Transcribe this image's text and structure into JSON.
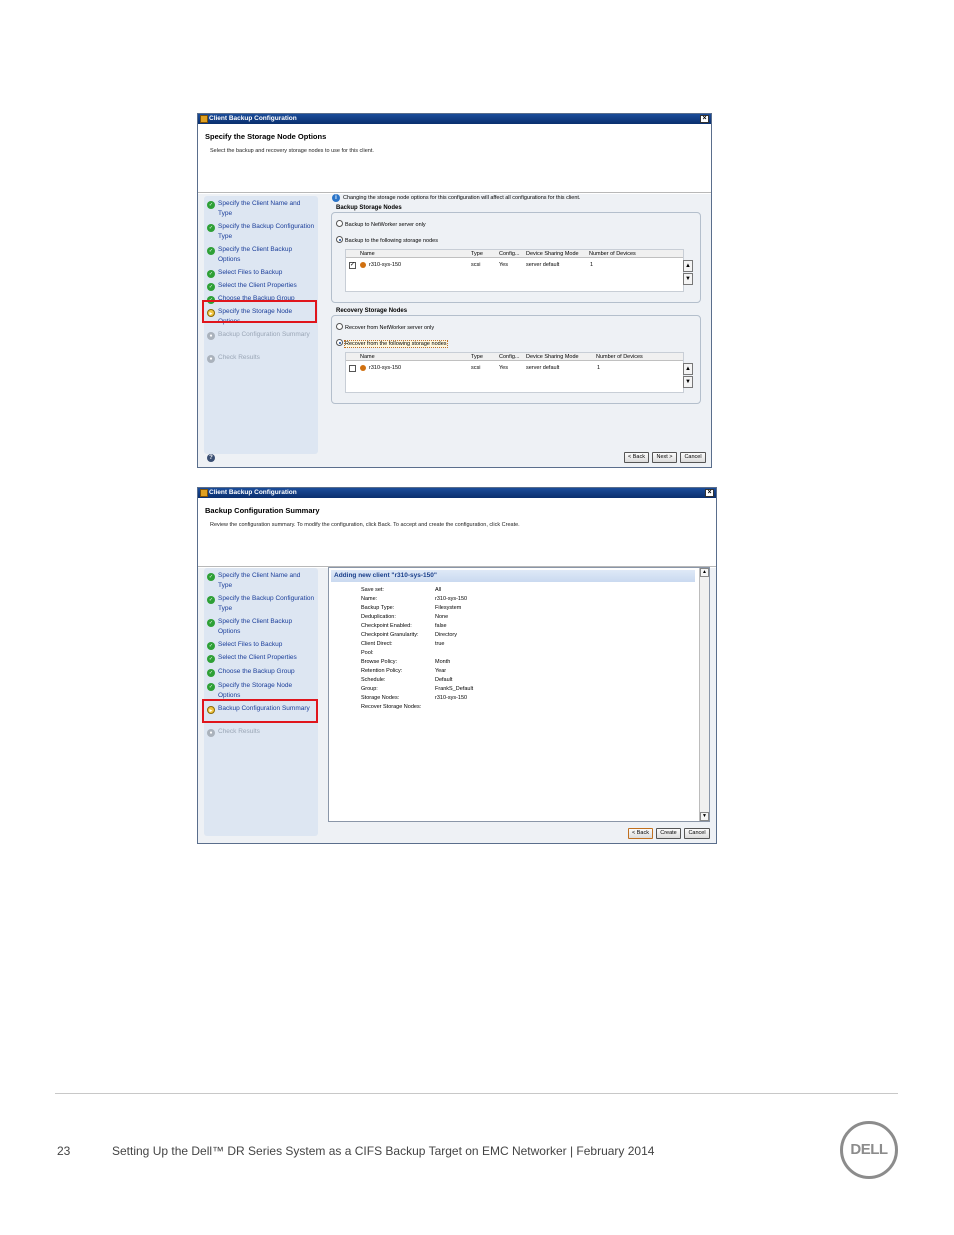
{
  "window1": {
    "title": "Client Backup Configuration",
    "heading": "Specify the Storage Node Options",
    "subheading": "Select the backup and recovery storage nodes to use for this client.",
    "steps": [
      {
        "label": "Specify the Client Name and Type",
        "state": "done"
      },
      {
        "label": "Specify the Backup Configuration Type",
        "state": "done"
      },
      {
        "label": "Specify the Client Backup Options",
        "state": "done"
      },
      {
        "label": "Select Files to Backup",
        "state": "done"
      },
      {
        "label": "Select the Client Properties",
        "state": "done"
      },
      {
        "label": "Choose the Backup Group",
        "state": "done"
      },
      {
        "label": "Specify the Storage Node Options",
        "state": "current"
      },
      {
        "label": "Backup Configuration Summary",
        "state": "pending"
      },
      {
        "label": "Check Results",
        "state": "pending"
      }
    ],
    "info_text": "Changing the storage node options for this configuration will affect all configurations for this client.",
    "backup_group": {
      "title": "Backup Storage Nodes",
      "option1": "Backup to NetWorker server only",
      "option2": "Backup to the following storage nodes",
      "columns": [
        "Name",
        "Type",
        "Config...",
        "Device Sharing Mode",
        "Number of Devices"
      ],
      "row": {
        "checked": true,
        "name": "r310-sys-150",
        "type": "scsi",
        "config": "Yes",
        "sharing": "server default",
        "devices": "1"
      }
    },
    "recovery_group": {
      "title": "Recovery Storage Nodes",
      "option1": "Recover from NetWorker server only",
      "option2": "Recover from the following storage nodes",
      "columns": [
        "Name",
        "Type",
        "Config...",
        "Device Sharing Mode",
        "Number of Devices"
      ],
      "row": {
        "checked": false,
        "name": "r310-sys-150",
        "type": "scsi",
        "config": "Yes",
        "sharing": "server default",
        "devices": "1"
      }
    },
    "buttons": {
      "back": "< Back",
      "next": "Next >",
      "cancel": "Cancel"
    }
  },
  "window2": {
    "title": "Client Backup Configuration",
    "heading": "Backup Configuration Summary",
    "subheading": "Review the configuration summary. To modify the configuration, click Back. To accept and create the configuration, click Create.",
    "steps": [
      {
        "label": "Specify the Client Name and Type",
        "state": "done"
      },
      {
        "label": "Specify the Backup Configuration Type",
        "state": "done"
      },
      {
        "label": "Specify the Client Backup Options",
        "state": "done"
      },
      {
        "label": "Select Files to Backup",
        "state": "done"
      },
      {
        "label": "Select the Client Properties",
        "state": "done"
      },
      {
        "label": "Choose the Backup Group",
        "state": "done"
      },
      {
        "label": "Specify the Storage Node Options",
        "state": "done"
      },
      {
        "label": "Backup Configuration Summary",
        "state": "current"
      },
      {
        "label": "Check Results",
        "state": "pending"
      }
    ],
    "summary_title": "Adding new client \"r310-sys-150\"",
    "summary": [
      {
        "k": "Save set:",
        "v": "All"
      },
      {
        "k": "Name:",
        "v": "r310-sys-150"
      },
      {
        "k": "Backup Type:",
        "v": "Filesystem"
      },
      {
        "k": "Deduplication:",
        "v": "None"
      },
      {
        "k": "Checkpoint Enabled:",
        "v": "false"
      },
      {
        "k": "Checkpoint Granularity:",
        "v": "Directory"
      },
      {
        "k": "Client Direct:",
        "v": "true"
      },
      {
        "k": "Pool:",
        "v": ""
      },
      {
        "k": "Browse Policy:",
        "v": "Month"
      },
      {
        "k": "Retention Policy:",
        "v": "Year"
      },
      {
        "k": "Schedule:",
        "v": "Default"
      },
      {
        "k": "Group:",
        "v": "FrankS_Default"
      },
      {
        "k": "Storage Nodes:",
        "v": "r310-sys-150"
      },
      {
        "k": "Recover Storage Nodes:",
        "v": ""
      }
    ],
    "buttons": {
      "back": "< Back",
      "create": "Create",
      "cancel": "Cancel"
    }
  },
  "footer": {
    "page_number": "23",
    "text": "Setting Up the Dell™ DR Series System as a CIFS Backup Target on EMC Networker | February 2014",
    "logo": "DELL"
  }
}
